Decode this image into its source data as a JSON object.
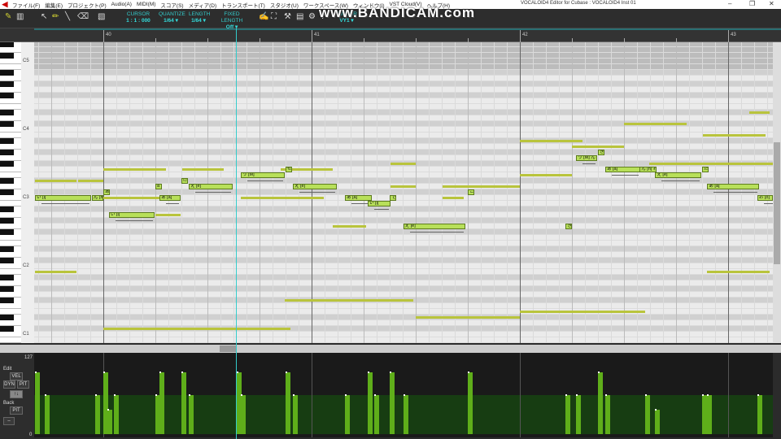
{
  "menu": {
    "items": [
      "ファイル(F)",
      "編集(E)",
      "プロジェクト(P)",
      "Audio(A)",
      "MIDI(M)",
      "スコア(S)",
      "メディア(D)",
      "トランスポート(T)",
      "スタジオ(U)",
      "ワークスペース(W)",
      "ウィンドウ(I)",
      "VST Cloud(V)",
      "ヘルプ(H)"
    ]
  },
  "window": {
    "title": "VOCALOID4 Editor for Cubase : VOCALOID4 Inst 01",
    "minimize": "–",
    "restore": "❐",
    "close": "✕"
  },
  "watermark": "www.BANDICAM.com",
  "toolbar": {
    "cursor": {
      "label": "CURSOR",
      "value": "1 : 1 : 000"
    },
    "quantize": {
      "label": "QUANTIZE",
      "value": "1/64 ▾"
    },
    "length": {
      "label": "LENGTH",
      "value": "1/64 ▾"
    },
    "fixed_length": {
      "label": "FIXED LENGTH",
      "value": "Off ▾"
    },
    "singer": {
      "label": "SINGER",
      "value": "VY1 ▾"
    }
  },
  "ruler": {
    "bars": [
      40,
      41,
      42,
      43
    ]
  },
  "keyboard": {
    "labels": [
      {
        "name": "C5",
        "semitone": 24
      },
      {
        "name": "C4",
        "semitone": 12
      },
      {
        "name": "C3",
        "semitone": 0
      },
      {
        "name": "C2",
        "semitone": -12
      },
      {
        "name": "C1",
        "semitone": -24
      }
    ]
  },
  "playhead_bar": 40.635,
  "notes": [
    {
      "lyric": "い [i]",
      "start": 39.672,
      "len": 0.27,
      "semi": 0
    },
    {
      "lyric": "ん [m]",
      "start": 39.945,
      "len": 0.055,
      "semi": 0
    },
    {
      "lyric": "あ",
      "start": 40.0,
      "len": 0.03,
      "semi": 1
    },
    {
      "lyric": "い [i]",
      "start": 40.027,
      "len": 0.22,
      "semi": -3
    },
    {
      "lyric": "あ [a]",
      "start": 40.27,
      "len": 0.1,
      "semi": 0
    },
    {
      "lyric": "a",
      "start": 40.25,
      "len": 0.03,
      "semi": 2
    },
    {
      "lyric": "け",
      "start": 40.375,
      "len": 0.03,
      "semi": 3
    },
    {
      "lyric": "え [e]",
      "start": 40.41,
      "len": 0.21,
      "semi": 2
    },
    {
      "lyric": "う [M]",
      "start": 40.66,
      "len": 0.21,
      "semi": 4
    },
    {
      "lyric": "せ",
      "start": 40.875,
      "len": 0.03,
      "semi": 5
    },
    {
      "lyric": "え [e]",
      "start": 40.91,
      "len": 0.21,
      "semi": 2
    },
    {
      "lyric": "あ [a]",
      "start": 41.16,
      "len": 0.13,
      "semi": 0
    },
    {
      "lyric": "い [i]",
      "start": 41.27,
      "len": 0.11,
      "semi": -1
    },
    {
      "lyric": "で",
      "start": 41.375,
      "len": 0.03,
      "semi": 0
    },
    {
      "lyric": "え [e]",
      "start": 41.44,
      "len": 0.3,
      "semi": -5
    },
    {
      "lyric": "こ",
      "start": 41.75,
      "len": 0.03,
      "semi": 1
    },
    {
      "lyric": "き",
      "start": 42.22,
      "len": 0.03,
      "semi": -5
    },
    {
      "lyric": "う [M] ん [m]",
      "start": 42.27,
      "len": 0.1,
      "semi": 7
    },
    {
      "lyric": "き",
      "start": 42.375,
      "len": 0.03,
      "semi": 8
    },
    {
      "lyric": "あ [a]",
      "start": 42.41,
      "len": 0.17,
      "semi": 5
    },
    {
      "lyric": "ん [n] わ",
      "start": 42.575,
      "len": 0.08,
      "semi": 5
    },
    {
      "lyric": "え [e]",
      "start": 42.65,
      "len": 0.22,
      "semi": 4
    },
    {
      "lyric": "た",
      "start": 42.875,
      "len": 0.03,
      "semi": 5
    },
    {
      "lyric": "あ [a]",
      "start": 42.9,
      "len": 0.25,
      "semi": 2
    },
    {
      "lyric": "お [o]",
      "start": 43.14,
      "len": 0.1,
      "semi": 0
    }
  ],
  "ghosts": [
    {
      "start": 39.672,
      "len": 0.2,
      "semi": 3
    },
    {
      "start": 39.88,
      "len": 0.12,
      "semi": 3
    },
    {
      "start": 40.0,
      "len": 0.3,
      "semi": 5
    },
    {
      "start": 40.38,
      "len": 0.2,
      "semi": 5
    },
    {
      "start": 40.0,
      "len": 0.35,
      "semi": 0
    },
    {
      "start": 40.25,
      "len": 0.12,
      "semi": -3
    },
    {
      "start": 40.85,
      "len": 0.25,
      "semi": 5
    },
    {
      "start": 40.66,
      "len": 0.4,
      "semi": 0
    },
    {
      "start": 41.1,
      "len": 0.13,
      "semi": -5
    },
    {
      "start": 41.38,
      "len": 0.12,
      "semi": 6
    },
    {
      "start": 41.38,
      "len": 0.12,
      "semi": 2
    },
    {
      "start": 41.63,
      "len": 0.1,
      "semi": 0
    },
    {
      "start": 41.75,
      "len": 0.25,
      "semi": 2
    },
    {
      "start": 42.0,
      "len": 0.25,
      "semi": 4
    },
    {
      "start": 42.25,
      "len": 0.25,
      "semi": 9
    },
    {
      "start": 42.62,
      "len": 0.7,
      "semi": 6
    },
    {
      "start": 42.0,
      "len": 0.3,
      "semi": 10
    },
    {
      "start": 42.5,
      "len": 0.3,
      "semi": 13
    },
    {
      "start": 42.88,
      "len": 0.3,
      "semi": 11
    },
    {
      "start": 43.1,
      "len": 0.1,
      "semi": 15
    },
    {
      "start": 39.672,
      "len": 0.2,
      "semi": -13
    },
    {
      "start": 40.0,
      "len": 0.9,
      "semi": -23
    },
    {
      "start": 40.87,
      "len": 0.62,
      "semi": -18
    },
    {
      "start": 41.5,
      "len": 0.5,
      "semi": -21
    },
    {
      "start": 42.0,
      "len": 0.2,
      "semi": -20
    },
    {
      "start": 42.2,
      "len": 0.4,
      "semi": -20
    },
    {
      "start": 42.9,
      "len": 0.3,
      "semi": -13
    },
    {
      "start": 41.14,
      "len": 0.12,
      "semi": -5
    },
    {
      "start": 41.63,
      "len": 0.12,
      "semi": 2
    }
  ],
  "lower": {
    "max": "127",
    "min": "0",
    "edit_label": "Edit",
    "edit_value": "VEL",
    "dyn": "DYN",
    "pit": "PIT",
    "back_label": "Back",
    "back_value": "PIT",
    "updown": "↑↓",
    "minus": "–"
  },
  "velocity": [
    {
      "bar": 39.672,
      "v": 100
    },
    {
      "bar": 39.72,
      "v": 64
    },
    {
      "bar": 39.96,
      "v": 64
    },
    {
      "bar": 40.0,
      "v": 100
    },
    {
      "bar": 40.02,
      "v": 40
    },
    {
      "bar": 40.05,
      "v": 64
    },
    {
      "bar": 40.25,
      "v": 64
    },
    {
      "bar": 40.27,
      "v": 100
    },
    {
      "bar": 40.375,
      "v": 100
    },
    {
      "bar": 40.41,
      "v": 64
    },
    {
      "bar": 40.64,
      "v": 100
    },
    {
      "bar": 40.66,
      "v": 64
    },
    {
      "bar": 40.875,
      "v": 100
    },
    {
      "bar": 40.91,
      "v": 64
    },
    {
      "bar": 41.16,
      "v": 64
    },
    {
      "bar": 41.27,
      "v": 100
    },
    {
      "bar": 41.3,
      "v": 64
    },
    {
      "bar": 41.375,
      "v": 100
    },
    {
      "bar": 41.44,
      "v": 64
    },
    {
      "bar": 41.75,
      "v": 100
    },
    {
      "bar": 42.22,
      "v": 64
    },
    {
      "bar": 42.27,
      "v": 64
    },
    {
      "bar": 42.375,
      "v": 100
    },
    {
      "bar": 42.41,
      "v": 64
    },
    {
      "bar": 42.6,
      "v": 64
    },
    {
      "bar": 42.65,
      "v": 40
    },
    {
      "bar": 42.875,
      "v": 64
    },
    {
      "bar": 42.9,
      "v": 64
    },
    {
      "bar": 43.14,
      "v": 64
    }
  ]
}
